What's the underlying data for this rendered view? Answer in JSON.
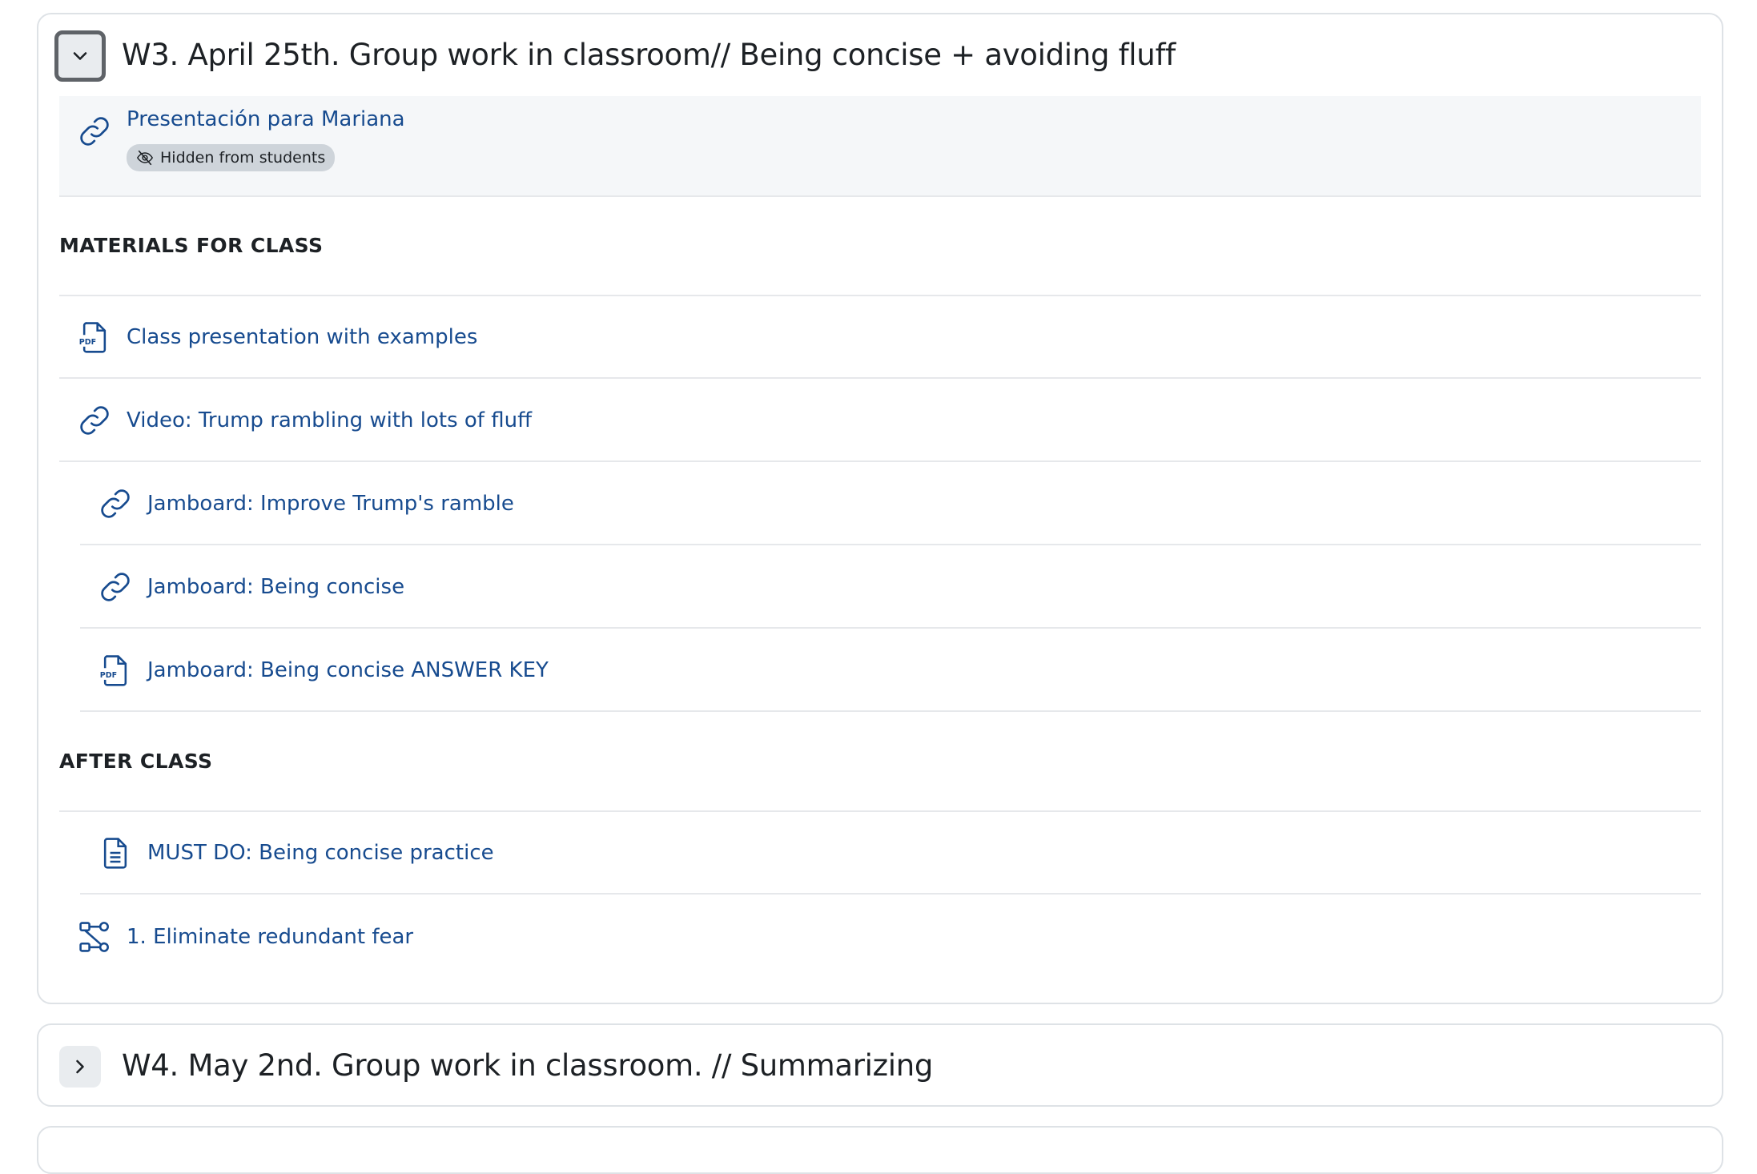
{
  "sections": [
    {
      "title": "W3. April 25th. Group work in classroom// Being concise + avoiding fluff",
      "expanded": true,
      "hidden_item": {
        "label": "Presentación para Mariana",
        "icon": "link-icon",
        "badge": "Hidden from students"
      },
      "headings": [
        "MATERIALS FOR CLASS",
        "AFTER CLASS"
      ],
      "materials": [
        {
          "label": "Class presentation with examples",
          "icon": "pdf-icon"
        },
        {
          "label": "Video: Trump rambling with lots of fluff",
          "icon": "link-icon"
        },
        {
          "label": "Jamboard: Improve Trump's ramble",
          "icon": "link-icon"
        },
        {
          "label": "Jamboard: Being concise",
          "icon": "link-icon"
        },
        {
          "label": "Jamboard: Being concise ANSWER KEY",
          "icon": "pdf-icon"
        }
      ],
      "after": [
        {
          "label": "MUST DO: Being concise practice",
          "icon": "document-icon"
        },
        {
          "label": "1. Eliminate redundant fear",
          "icon": "workflow-icon"
        }
      ]
    },
    {
      "title": "W4. May 2nd. Group work in classroom. // Summarizing",
      "expanded": false
    }
  ],
  "colors": {
    "link": "#174b8f",
    "text": "#1d2125",
    "border": "#dee2e6",
    "badge_bg": "#ced4da"
  }
}
